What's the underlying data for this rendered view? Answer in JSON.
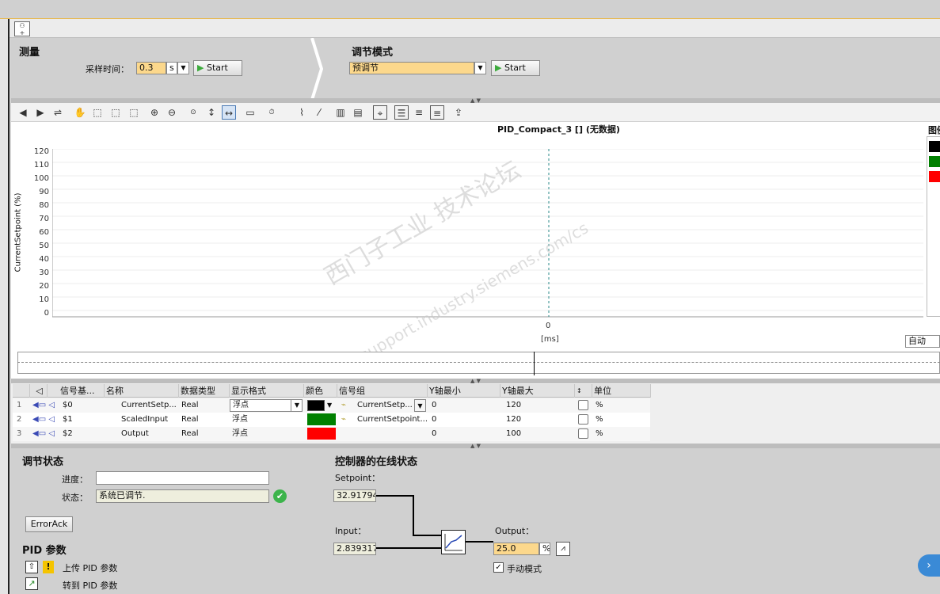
{
  "measure": {
    "title": "测量",
    "sample_time_label": "采样时间：",
    "sample_time_value": "0.3",
    "sample_time_unit": "s",
    "start_label": "Start"
  },
  "tuning_mode": {
    "title": "调节模式",
    "value": "预调节",
    "start_label": "Start"
  },
  "chart": {
    "title": "PID_Compact_3 [] (无数据)",
    "ylabel": "CurrentSetpoint (%)",
    "yticks": [
      "120",
      "110",
      "100",
      "90",
      "80",
      "70",
      "60",
      "50",
      "40",
      "30",
      "20",
      "10",
      "0"
    ],
    "xtick": "0",
    "xunit": "[ms]",
    "legend_title": "图例",
    "legend_colors": [
      "#000000",
      "#008000",
      "#ff0000"
    ],
    "mode_select": "自动",
    "watermark_cn": "西门子工业 技术论坛",
    "watermark_url": "support.industry.siemens.com/cs"
  },
  "chart_data": {
    "type": "line",
    "title": "PID_Compact_3 [] (无数据)",
    "xlabel": "[ms]",
    "ylabel": "CurrentSetpoint (%)",
    "ylim": [
      0,
      120
    ],
    "grid": true,
    "series": []
  },
  "signal_table": {
    "headers": [
      "信号基...",
      "名称",
      "数据类型",
      "显示格式",
      "颜色",
      "信号组",
      "Y轴最小",
      "Y轴最大",
      "单位"
    ],
    "rows": [
      {
        "num": "1",
        "base": "$0",
        "name": "CurrentSetp...",
        "type": "Real",
        "format": "浮点",
        "color": "#000000",
        "group": "CurrentSetp...",
        "ymin": "0",
        "ymax": "120",
        "unit": "%"
      },
      {
        "num": "2",
        "base": "$1",
        "name": "ScaledInput",
        "type": "Real",
        "format": "浮点",
        "color": "#008000",
        "group": "CurrentSetpoint...",
        "ymin": "0",
        "ymax": "120",
        "unit": "%"
      },
      {
        "num": "3",
        "base": "$2",
        "name": "Output",
        "type": "Real",
        "format": "浮点",
        "color": "#ff0000",
        "group": "",
        "ymin": "0",
        "ymax": "100",
        "unit": "%"
      }
    ]
  },
  "tuning_status": {
    "title": "调节状态",
    "progress_label": "进度：",
    "progress_value": "",
    "status_label": "状态：",
    "status_value": "系统已调节.",
    "error_ack": "ErrorAck"
  },
  "pid_params": {
    "title": "PID 参数",
    "upload": "上传 PID 参数",
    "goto": "转到 PID 参数"
  },
  "online_state": {
    "title": "控制器的在线状态",
    "setpoint_label": "Setpoint：",
    "setpoint_value": "32.91794",
    "input_label": "Input：",
    "input_value": "2.839317",
    "output_label": "Output：",
    "output_value": "25.0",
    "output_unit": "%",
    "manual_mode": "手动模式"
  }
}
